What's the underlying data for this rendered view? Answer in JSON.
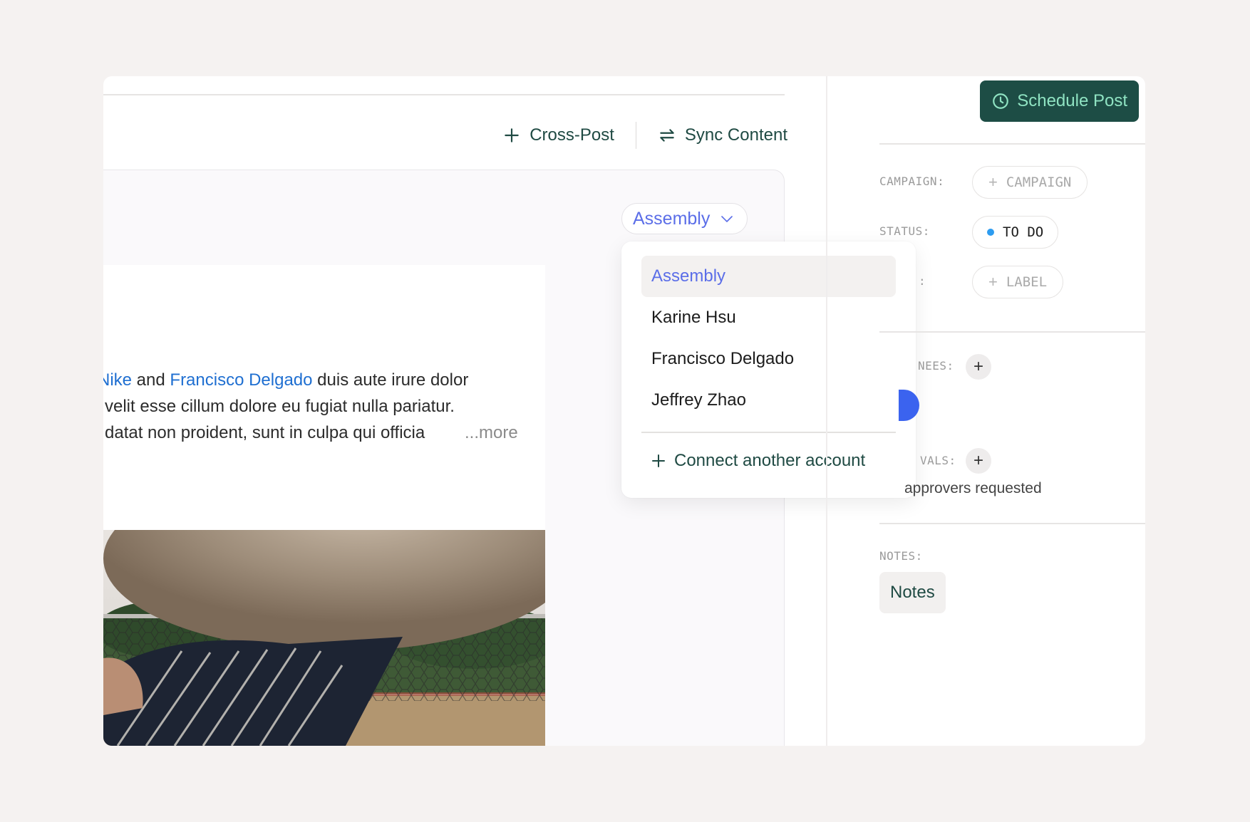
{
  "toolbar": {
    "cross_post_label": "Cross-Post",
    "sync_content_label": "Sync Content"
  },
  "account_select": {
    "selected": "Assembly"
  },
  "dropdown": {
    "items": [
      "Assembly",
      "Karine Hsu",
      "Francisco Delgado",
      "Jeffrey Zhao"
    ],
    "selected_index": 0,
    "connect_label": "Connect another account"
  },
  "post": {
    "line1_mention1": "Nike",
    "line1_mid": " and ",
    "line1_mention2": "Francisco Delgado",
    "line1_rest": " duis aute irure dolor",
    "line2": "velit esse cillum dolore eu fugiat nulla pariatur.",
    "line3": "datat non proident, sunt in culpa qui officia",
    "more": "...more"
  },
  "sidebar": {
    "schedule_label": "Schedule Post",
    "campaign_label": "CAMPAIGN:",
    "campaign_button": "CAMPAIGN",
    "status_label": "STATUS:",
    "status_value": "TO DO",
    "labels_label": ":",
    "label_button": "LABEL",
    "assignees_label": "NEES:",
    "approvals_label": "VALS:",
    "approvers_text": "approvers requested",
    "notes_label": "NOTES:",
    "notes_button": "Notes"
  },
  "colors": {
    "accent": "#1d4d45",
    "accent_text": "#8fe3c2",
    "mention": "#1f6fd1",
    "selected_account": "#5b6ee8",
    "status_dot": "#2d9cf0"
  }
}
